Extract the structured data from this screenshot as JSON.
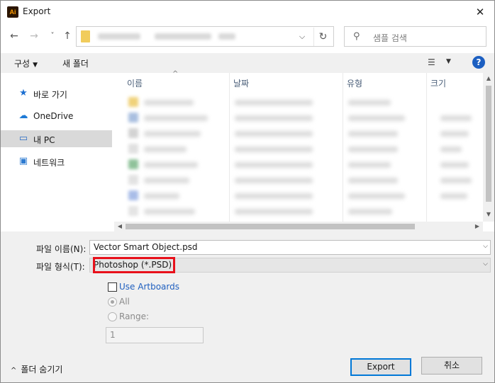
{
  "window": {
    "title": "Export",
    "app_icon_text": "Ai",
    "close_glyph": "✕"
  },
  "nav": {
    "back_icon": "←",
    "forward_icon": "→",
    "recent_icon": "˅",
    "up_icon": "↑",
    "dropdown_icon": "⌵",
    "refresh_icon": "↻"
  },
  "search": {
    "icon": "⚲",
    "placeholder": "샘플 검색"
  },
  "toolbar": {
    "organize_label": "구성",
    "new_folder_label": "새 폴더",
    "caret": "▼",
    "view_icon": "☰",
    "help_label": "?"
  },
  "sidebar": {
    "items": [
      {
        "label": "바로 가기",
        "icon": "★",
        "icon_color": "#1c6fd1"
      },
      {
        "label": "OneDrive",
        "icon": "☁",
        "icon_color": "#1d7ad6"
      },
      {
        "label": "내 PC",
        "icon": "▭",
        "icon_color": "#2b6cc4"
      },
      {
        "label": "네트워크",
        "icon": "▣",
        "icon_color": "#2e7bd1"
      }
    ]
  },
  "file_list": {
    "columns": [
      "이름",
      "날짜",
      "유형",
      "크기"
    ],
    "sort_indicator": "^"
  },
  "form": {
    "filename_label": "파일 이름(N):",
    "filename_value": "Vector Smart Object.psd",
    "filetype_label": "파일 형식(T):",
    "filetype_value": "Photoshop (*.PSD)",
    "use_artboards_label": "Use Artboards",
    "use_artboards_checked": false,
    "all_label": "All",
    "range_label": "Range:",
    "range_value": "1",
    "dropdown_icon": "⌵"
  },
  "footer": {
    "hide_folders_label": "폴더 숨기기",
    "hide_folders_icon": "^",
    "export_label": "Export",
    "cancel_label": "취소"
  },
  "colors": {
    "highlight_box": "#e8101a",
    "link": "#1f5fbf",
    "default_button_border": "#0078d7"
  }
}
